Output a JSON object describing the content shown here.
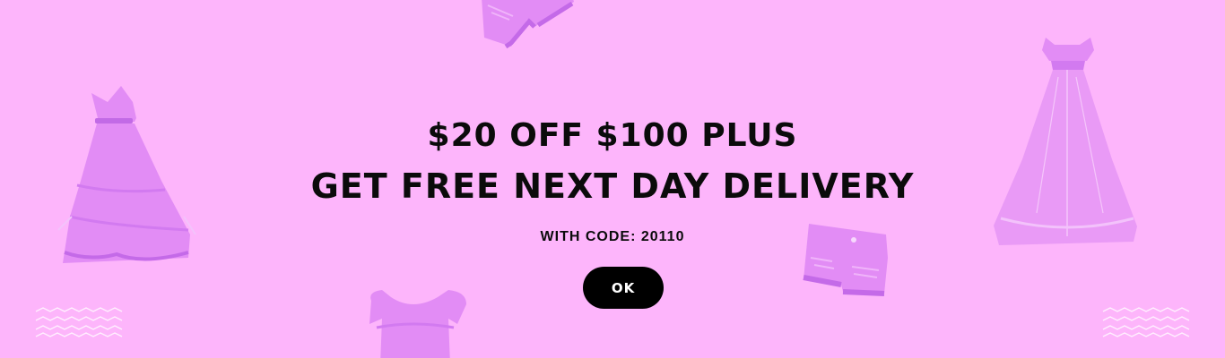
{
  "promo": {
    "headline_line1": "$20 OFF $100 PLUS",
    "headline_line2": "GET FREE NEXT DAY DELIVERY",
    "code_text": "WITH CODE: 20110",
    "ok_label": "OK"
  },
  "colors": {
    "background": "#fdb5fb",
    "clothing": "#e28cf5",
    "text": "#0b0b0b",
    "button": "#000000",
    "button_text": "#ffffff"
  },
  "decorations": [
    "dress-icon",
    "gown-icon",
    "shorts-icon",
    "crop-top-icon",
    "zigzag-pattern"
  ]
}
